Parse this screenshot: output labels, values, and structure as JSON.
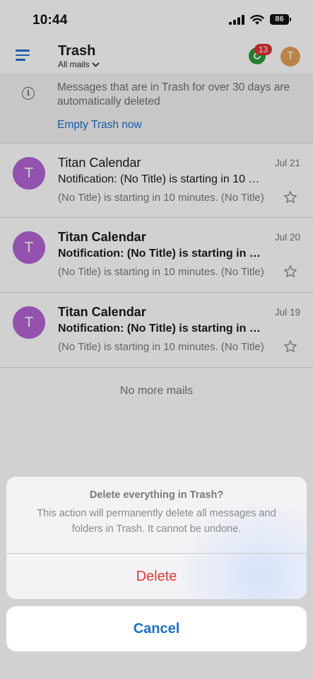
{
  "status_bar": {
    "time": "10:44",
    "battery": "86"
  },
  "header": {
    "title": "Trash",
    "filter_label": "All mails",
    "sync_badge": "13",
    "avatar_initial": "T"
  },
  "banner": {
    "message": "Messages that are in Trash for over 30 days are automatically deleted",
    "action_label": "Empty Trash now"
  },
  "mails": [
    {
      "avatar": "T",
      "sender": "Titan Calendar",
      "date": "Jul 21",
      "subject": "Notification: (No Title) is starting in 10 minutes",
      "preview": "(No Title) is starting in 10 minutes. (No Title)",
      "read": true
    },
    {
      "avatar": "T",
      "sender": "Titan Calendar",
      "date": "Jul 20",
      "subject": "Notification: (No Title) is starting in 10 minutes",
      "preview": "(No Title) is starting in 10 minutes. (No Title)",
      "read": false
    },
    {
      "avatar": "T",
      "sender": "Titan Calendar",
      "date": "Jul 19",
      "subject": "Notification: (No Title) is starting in 10 minutes",
      "preview": "(No Title) is starting in 10 minutes. (No Title)",
      "read": false
    }
  ],
  "list_footer": "No more mails",
  "dialog": {
    "title": "Delete everything in Trash?",
    "message": "This action will permanently delete all messages and folders in Trash. It cannot be undone.",
    "delete_label": "Delete",
    "cancel_label": "Cancel"
  },
  "colors": {
    "accent": "#1c6fd1",
    "destructive": "#e03a3a",
    "avatar": "#b565d6",
    "sync": "#2a9d3a",
    "badge": "#e03131"
  }
}
